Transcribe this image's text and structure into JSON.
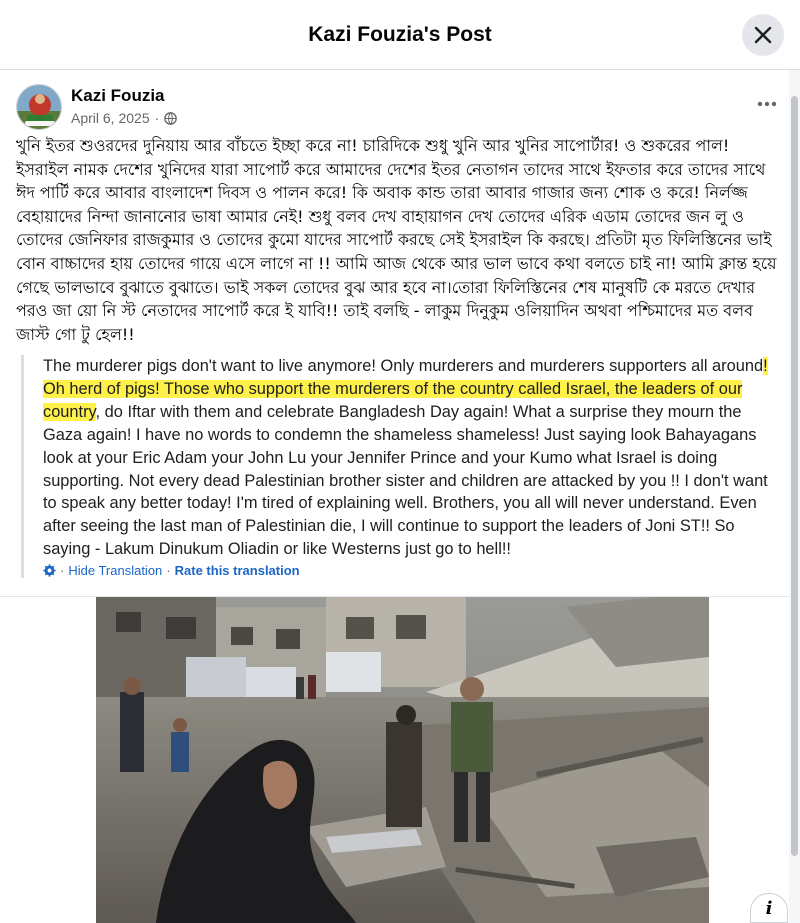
{
  "dialog": {
    "title": "Kazi Fouzia's Post",
    "close_icon": "close-icon"
  },
  "post": {
    "author": "Kazi Fouzia",
    "date": "April 6, 2025",
    "separator": "·",
    "audience_icon": "globe-icon",
    "more_icon": "more-options-icon",
    "text": "খুনি ইতর শুওরদের দুনিয়ায় আর বাঁচতে ইচ্ছা করে না! চারিদিকে শুধু খুনি আর খুনির সাপোর্টার! ও শুকরের পাল! ইসরাইল নামক দেশের খুনিদের যারা সাপোর্ট করে আমাদের দেশের ইতর নেতাগন তাদের সাথে ইফতার করে তাদের সাথে ঈদ পার্টি করে আবার বাংলাদেশ দিবস ও পালন করে! কি অবাক কান্ড তারা আবার গাজার জন্য শোক ও করে! নির্লজ্জ বেহায়াদের নিন্দা জানানোর ভাষা আমার নেই! শুধু বলব দেখ বাহায়াগন দেখ তোদের এরিক এডাম তোদের জন লু ও তোদের জেনিফার রাজকুমার ও তোদের কুমো যাদের সাপোর্ট করছে সেই ইসরাইল কি করছে। প্রতিটা মৃত ফিলিস্তিনের ভাই বোন বাচ্চাদের হায় তোদের গায়ে এসে লাগে না !! আমি আজ থেকে আর ভাল ভাবে কথা বলতে চাই না! আমি ক্লান্ত হয়ে গেছে ভালভাবে বুঝাতে বুঝাতে। ভাই সকল তোদের বুঝ আর হবে না।তোরা ফিলিস্তিনের শেষ মানুষটি কে মরতে দেখার পরও জা য়ো নি স্ট নেতাদের সাপোর্ট করে ই যাবি!! তাই বলছি - লাকুম দিনুকুম ওলিয়াদিন অথবা পশ্চিমাদের মত বলব জাস্ট গো টু হেল!!"
  },
  "translation": {
    "part1": "The murderer pigs don't want to live anymore! Only murderers and murderers supporters all around",
    "highlight": "! Oh herd of pigs! Those who support the murderers of the country called Israel, the leaders of our country",
    "part2": ", do Iftar with them and celebrate Bangladesh Day again! What a surprise they mourn the Gaza again! I have no words to condemn the shameless shameless! Just saying look Bahayagans look at your Eric Adam your John Lu your Jennifer Prince and your Kumo what Israel is doing supporting. Not every dead Palestinian brother sister and children are attacked by you !! I don't want to speak any better today! I'm tired of explaining well. Brothers, you all will never understand. Even after seeing the last man of Palestinian die, I will continue to support the leaders of Joni ST!! So saying - Lakum Dinukum Oliadin or like Westerns just go to hell!!",
    "settings_icon": "gear-icon",
    "dot": "·",
    "hide_label": "Hide Translation",
    "rate_label": "Rate this translation"
  },
  "photo": {
    "icon": "photo-image"
  },
  "info_label": "i",
  "colors": {
    "link": "#1b66c9",
    "highlight": "#fff14a",
    "secondary_text": "#65676b"
  }
}
